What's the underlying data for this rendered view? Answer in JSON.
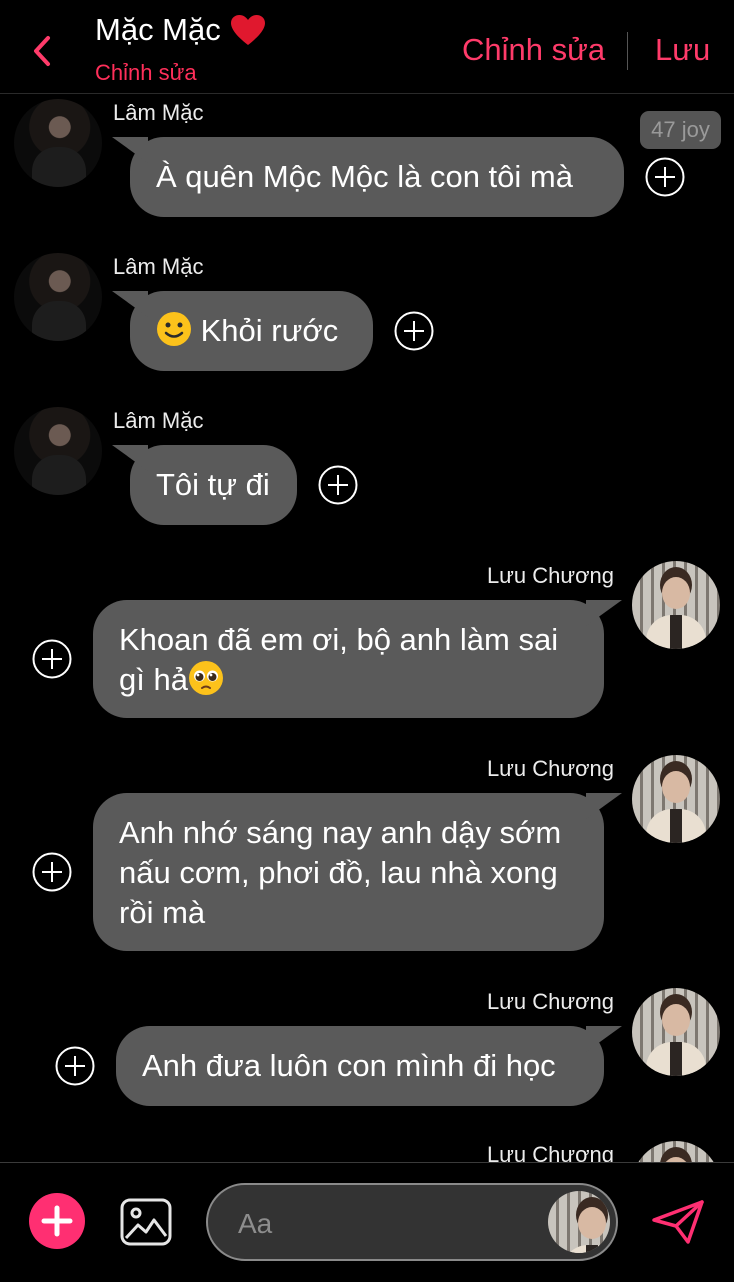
{
  "header": {
    "title": "Mặc Mặc",
    "subtitle": "Chỉnh sửa",
    "edit_label": "Chỉnh sửa",
    "save_label": "Lưu"
  },
  "colors": {
    "accent": "#ff3b6a",
    "bubble": "#5a5a5a",
    "background": "#000000"
  },
  "messages": [
    {
      "sender": "Lâm Mặc",
      "side": "left",
      "lines": [
        "À quên Mộc Mộc là con tôi mà"
      ],
      "badge": "47 joy"
    },
    {
      "sender": "Lâm Mặc",
      "side": "left",
      "emoji": "slight-smile-emoji",
      "lines": [
        "Khỏi rước"
      ]
    },
    {
      "sender": "Lâm Mặc",
      "side": "left",
      "lines": [
        "Tôi tự đi"
      ]
    },
    {
      "sender": "Lưu Chương",
      "side": "right",
      "lines": [
        "Khoan đã em ơi, bộ anh làm sai",
        "gì hả"
      ],
      "emoji": "pleading-face-emoji"
    },
    {
      "sender": "Lưu Chương",
      "side": "right",
      "lines": [
        "Anh nhớ sáng nay anh dậy sớm",
        "nấu cơm, phơi đồ, lau nhà xong",
        "rồi mà"
      ]
    },
    {
      "sender": "Lưu Chương",
      "side": "right",
      "lines": [
        "Anh đưa luôn con mình đi học"
      ]
    },
    {
      "sender": "Lưu Chương",
      "side": "right",
      "lines": []
    }
  ],
  "composer": {
    "placeholder": "Aa"
  }
}
